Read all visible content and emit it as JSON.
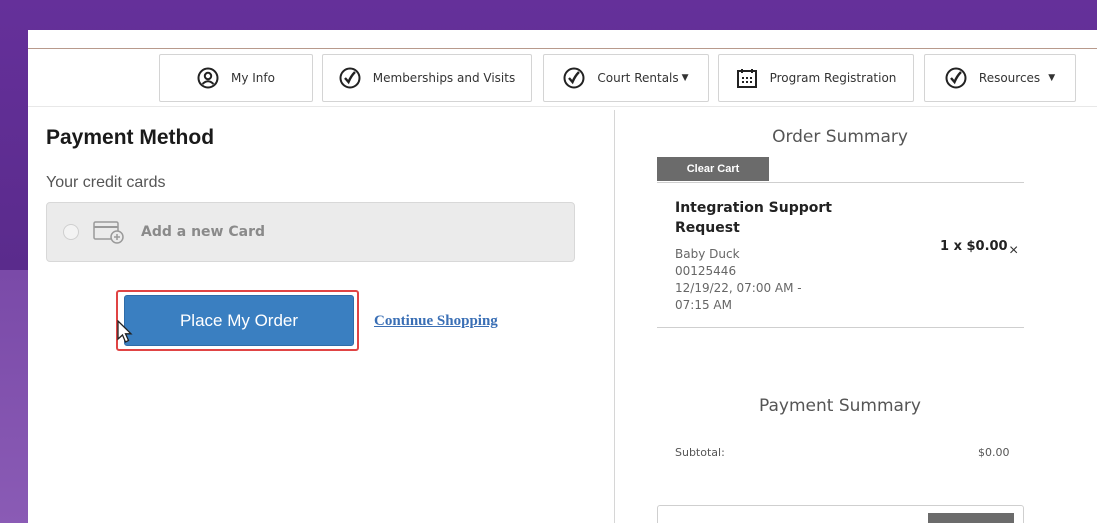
{
  "nav": {
    "items": [
      {
        "label": "My Info",
        "icon": "user-circle-icon",
        "caret": ""
      },
      {
        "label": "Memberships and Visits",
        "icon": "check-logo-icon",
        "caret": ""
      },
      {
        "label": "Court Rentals",
        "icon": "check-logo-icon",
        "caret": "▼"
      },
      {
        "label": "Program Registration",
        "icon": "calendar-icon",
        "caret": ""
      },
      {
        "label": "Resources",
        "icon": "check-logo-icon",
        "caret": "▼"
      }
    ]
  },
  "payment": {
    "title": "Payment Method",
    "cards_label": "Your credit cards",
    "add_card_label": "Add a new Card",
    "place_order_label": "Place My Order",
    "continue_label": "Continue Shopping"
  },
  "order_summary": {
    "title": "Order Summary",
    "clear_cart_label": "Clear Cart",
    "item": {
      "name": "Integration Support Request",
      "person": "Baby Duck",
      "id": "00125446",
      "time_line1": "12/19/22, 07:00 AM -",
      "time_line2": "07:15 AM",
      "quantity": "1 x $0.00",
      "remove": "×"
    }
  },
  "payment_summary": {
    "title": "Payment Summary",
    "subtotal_label": "Subtotal:",
    "subtotal_value": "$0.00"
  },
  "colors": {
    "background_purple": "#5b2c8e",
    "primary_button": "#3a7fc1",
    "highlight_border": "#e04444",
    "clear_cart_gray": "#6b6b6b"
  }
}
